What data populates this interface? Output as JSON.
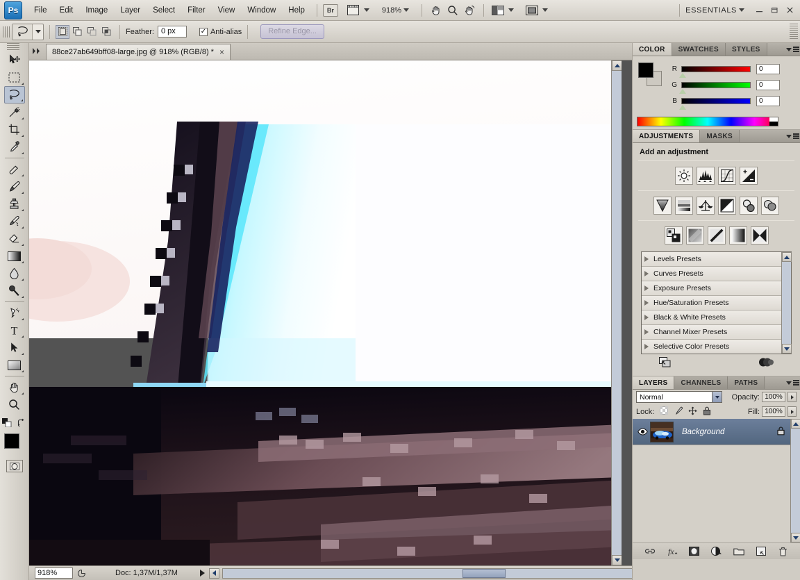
{
  "app": {
    "logo": "Ps",
    "workspace": "ESSENTIALS",
    "zoom_toolbar": "918%"
  },
  "menubar": {
    "items": [
      {
        "label": "File"
      },
      {
        "label": "Edit"
      },
      {
        "label": "Image"
      },
      {
        "label": "Layer"
      },
      {
        "label": "Select"
      },
      {
        "label": "Filter"
      },
      {
        "label": "View"
      },
      {
        "label": "Window"
      },
      {
        "label": "Help"
      }
    ],
    "bridge_label": "Br",
    "icons": [
      "bridge-icon",
      "view-extras-icon",
      "hand-icon",
      "zoom-icon",
      "rotate-view-icon",
      "arrange-documents-icon",
      "screen-mode-icon"
    ],
    "window_controls": [
      "minimize",
      "restore",
      "close"
    ]
  },
  "options_bar": {
    "tool": "lasso-tool",
    "selection_modes": [
      "new-selection",
      "add-to-selection",
      "subtract-from-selection",
      "intersect-with-selection"
    ],
    "active_selection_mode": "new-selection",
    "feather_label": "Feather:",
    "feather_value": "0 px",
    "antialias_label": "Anti-alias",
    "antialias_checked": true,
    "refine_edge_label": "Refine Edge...",
    "refine_edge_enabled": false
  },
  "toolbar": {
    "tools": [
      {
        "name": "move-tool",
        "glyph": "move"
      },
      {
        "name": "rectangular-marquee-tool",
        "glyph": "marquee"
      },
      {
        "name": "lasso-tool",
        "glyph": "lasso",
        "selected": true
      },
      {
        "name": "quick-selection-tool",
        "glyph": "wand"
      },
      {
        "name": "crop-tool",
        "glyph": "crop"
      },
      {
        "name": "eyedropper-tool",
        "glyph": "eyedropper"
      },
      {
        "name": "spot-healing-brush-tool",
        "glyph": "healing"
      },
      {
        "name": "brush-tool",
        "glyph": "brush"
      },
      {
        "name": "clone-stamp-tool",
        "glyph": "stamp"
      },
      {
        "name": "history-brush-tool",
        "glyph": "historybrush"
      },
      {
        "name": "eraser-tool",
        "glyph": "eraser"
      },
      {
        "name": "gradient-tool",
        "glyph": "gradient"
      },
      {
        "name": "blur-tool",
        "glyph": "blur"
      },
      {
        "name": "dodge-tool",
        "glyph": "dodge"
      },
      {
        "name": "pen-tool",
        "glyph": "pen"
      },
      {
        "name": "horizontal-type-tool",
        "glyph": "T"
      },
      {
        "name": "path-selection-tool",
        "glyph": "pathselect"
      },
      {
        "name": "rectangle-tool",
        "glyph": "rect"
      },
      {
        "name": "hand-tool",
        "glyph": "hand"
      },
      {
        "name": "zoom-tool",
        "glyph": "zoom"
      }
    ],
    "foreground_color": "#000000",
    "background_color": "#ffffff"
  },
  "document": {
    "tab_title": "88ce27ab649bff08-large.jpg @ 918% (RGB/8) *",
    "close_glyph": "×"
  },
  "status_bar": {
    "zoom_value": "918%",
    "doc_label": "Doc: 1,37M/1,37M"
  },
  "color_panel": {
    "tabs": [
      "COLOR",
      "SWATCHES",
      "STYLES"
    ],
    "active_tab": "COLOR",
    "channels": [
      {
        "label": "R",
        "value": "0",
        "color": "#ff0000"
      },
      {
        "label": "G",
        "value": "0",
        "color": "#00ff00"
      },
      {
        "label": "B",
        "value": "0",
        "color": "#0000ff"
      }
    ],
    "foreground": "#000000",
    "background": "#cdc9c1"
  },
  "adjustments_panel": {
    "tabs": [
      "ADJUSTMENTS",
      "MASKS"
    ],
    "active_tab": "ADJUSTMENTS",
    "title": "Add an adjustment",
    "row1": [
      "brightness-contrast-icon",
      "levels-icon",
      "curves-icon",
      "exposure-icon"
    ],
    "row2": [
      "vibrance-icon",
      "hue-saturation-icon",
      "color-balance-icon",
      "black-white-icon",
      "photo-filter-icon",
      "channel-mixer-icon"
    ],
    "row3": [
      "invert-icon",
      "posterize-icon",
      "threshold-icon",
      "gradient-map-icon",
      "selective-color-icon"
    ],
    "presets": [
      "Levels Presets",
      "Curves Presets",
      "Exposure Presets",
      "Hue/Saturation Presets",
      "Black & White Presets",
      "Channel Mixer Presets",
      "Selective Color Presets"
    ],
    "footer_icons": [
      "return-to-adjustment-list-icon",
      "clip-to-layer-icon"
    ]
  },
  "layers_panel": {
    "tabs": [
      "LAYERS",
      "CHANNELS",
      "PATHS"
    ],
    "active_tab": "LAYERS",
    "blend_mode": "Normal",
    "opacity_label": "Opacity:",
    "opacity_value": "100%",
    "lock_label": "Lock:",
    "lock_icons": [
      "lock-transparent-pixels-icon",
      "lock-image-pixels-icon",
      "lock-position-icon",
      "lock-all-icon"
    ],
    "fill_label": "Fill:",
    "fill_value": "100%",
    "layers": [
      {
        "name": "Background",
        "visible": true,
        "locked": true
      }
    ],
    "footer_icons": [
      "link-layers-icon",
      "layer-style-icon",
      "layer-mask-icon",
      "new-adjustment-layer-icon",
      "new-group-icon",
      "new-layer-icon",
      "delete-layer-icon"
    ]
  },
  "canvas": {
    "image_description": "pixelated-photo-zoomed-918-percent"
  }
}
